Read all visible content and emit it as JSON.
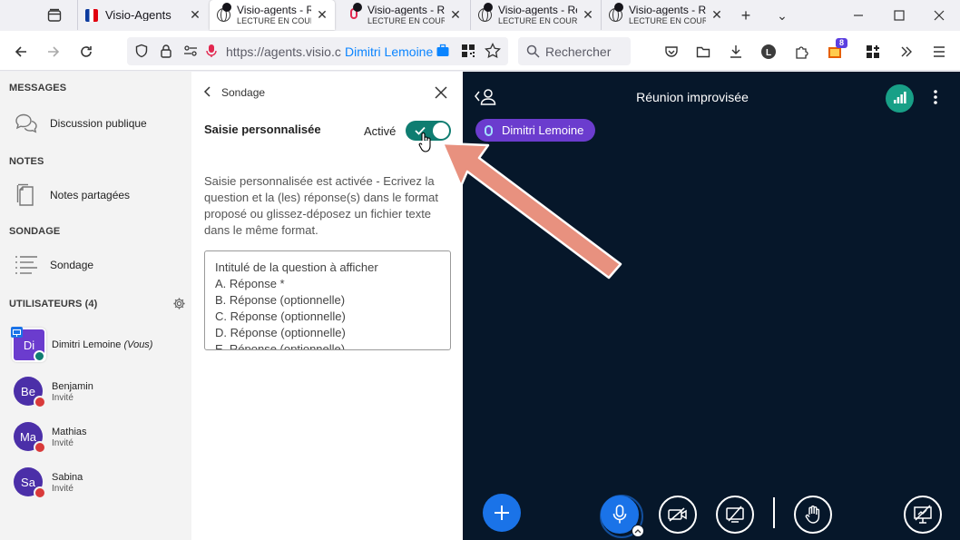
{
  "browser": {
    "tabs": [
      {
        "title": "Visio-Agents",
        "subtitle": ""
      },
      {
        "title": "Visio-agents - Ré",
        "subtitle": "LECTURE EN COURS"
      },
      {
        "title": "Visio-agents - Ré",
        "subtitle": "LECTURE EN COURS"
      },
      {
        "title": "Visio-agents - Ré",
        "subtitle": "LECTURE EN COURS"
      },
      {
        "title": "Visio-agents - Ré",
        "subtitle": "LECTURE EN COURS"
      }
    ],
    "url": "https://agents.visio.c",
    "url_user": "Dimitri Lemoine",
    "search_placeholder": "Rechercher",
    "extension_badge": "8"
  },
  "sidebar": {
    "messages_title": "MESSAGES",
    "public_chat": "Discussion publique",
    "notes_title": "NOTES",
    "shared_notes": "Notes partagées",
    "poll_title": "SONDAGE",
    "poll_item": "Sondage",
    "users_title": "UTILISATEURS (4)",
    "users": [
      {
        "initials": "Di",
        "name": "Dimitri Lemoine",
        "suffix": "(Vous)",
        "role": "",
        "color": "#6b3cce"
      },
      {
        "initials": "Be",
        "name": "Benjamin",
        "suffix": "",
        "role": "Invité",
        "color": "#4b2fa8"
      },
      {
        "initials": "Ma",
        "name": "Mathias",
        "suffix": "",
        "role": "Invité",
        "color": "#4b2fa8"
      },
      {
        "initials": "Sa",
        "name": "Sabina",
        "suffix": "",
        "role": "Invité",
        "color": "#4b2fa8"
      }
    ]
  },
  "panel": {
    "header": "Sondage",
    "custom_input_label": "Saisie personnalisée",
    "toggle_label": "Activé",
    "toggle_on": true,
    "description": "Saisie personnalisée est activée - Ecrivez la question et la (les) réponse(s) dans le format proposé ou glissez-déposez un fichier texte dans le même format.",
    "textarea_lines": [
      "Intitulé de la question à afficher",
      "A. Réponse *",
      "B. Réponse (optionnelle)",
      "C. Réponse (optionnelle)",
      "D. Réponse (optionnelle)",
      "E. Réponse (optionnelle)"
    ]
  },
  "meeting": {
    "title": "Réunion improvisée",
    "speaker": "Dimitri Lemoine"
  },
  "colors": {
    "toggle": "#0f7d71",
    "meeting_bg": "#06172a",
    "speaker_pill": "#6b3cce",
    "arrow": "#e8917f",
    "fab": "#1a73e8"
  }
}
